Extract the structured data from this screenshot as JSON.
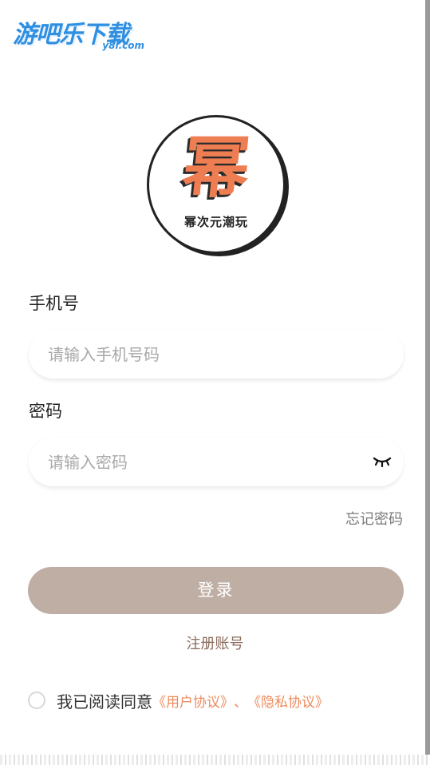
{
  "watermark": {
    "main": "游吧乐下载",
    "sub": "y8l.com"
  },
  "logo": {
    "char": "幂",
    "text": "幂次元潮玩"
  },
  "form": {
    "phone_label": "手机号",
    "phone_placeholder": "请输入手机号码",
    "password_label": "密码",
    "password_placeholder": "请输入密码",
    "eye_icon": "eye-closed-icon",
    "forgot_label": "忘记密码"
  },
  "actions": {
    "login_label": "登录",
    "register_label": "注册账号"
  },
  "agreement": {
    "prefix": "我已阅读同意",
    "user_link": "《用户协议》",
    "separator": "、",
    "privacy_link": "《隐私协议》"
  },
  "colors": {
    "accent": "#ee7d52",
    "button": "#bfaea4",
    "link": "#ee8a5e",
    "register_text": "#8a6a5b"
  }
}
